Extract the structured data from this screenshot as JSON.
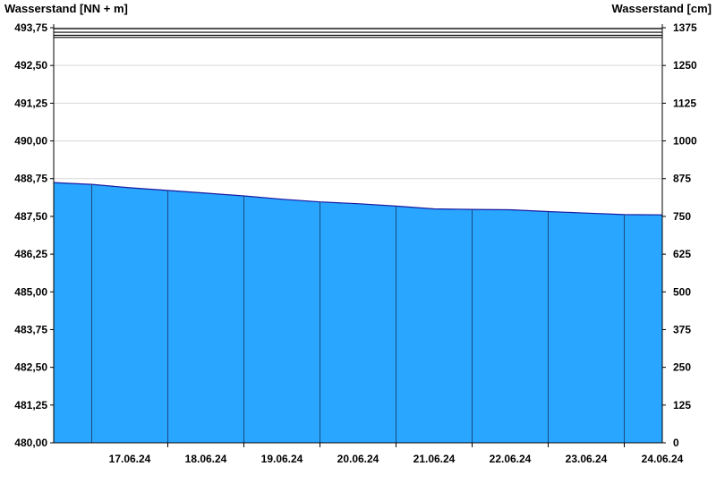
{
  "chart_data": {
    "type": "area",
    "ylabel_left": "Wasserstand [NN + m]",
    "ylabel_right": "Wasserstand [cm]",
    "left_axis": {
      "ylim": [
        480.0,
        493.75
      ],
      "ticks": [
        "480,00",
        "481,25",
        "482,50",
        "483,75",
        "485,00",
        "486,25",
        "487,50",
        "488,75",
        "490,00",
        "491,25",
        "492,50",
        "493,75"
      ]
    },
    "right_axis": {
      "ylim": [
        0,
        1375
      ],
      "ticks": [
        "0",
        "125",
        "250",
        "375",
        "500",
        "625",
        "750",
        "875",
        "1000",
        "1125",
        "1250",
        "1375"
      ]
    },
    "x_axis": {
      "range": [
        "16.06.24 12:00",
        "24.06.24 12:00"
      ],
      "ticks": [
        "17.06.24",
        "18.06.24",
        "19.06.24",
        "20.06.24",
        "21.06.24",
        "22.06.24",
        "23.06.24",
        "24.06.24"
      ]
    },
    "threshold_lines_cm": [
      1372,
      1360,
      1350,
      1343
    ],
    "grid": true,
    "fill_color": "#29a6ff",
    "series": [
      {
        "x": [
          "16.06.24 12:00",
          "17.06.24 00:00",
          "17.06.24 12:00",
          "18.06.24 00:00",
          "18.06.24 12:00",
          "19.06.24 00:00",
          "19.06.24 12:00",
          "20.06.24 00:00",
          "20.06.24 12:00",
          "21.06.24 00:00",
          "21.06.24 12:00",
          "22.06.24 00:00",
          "22.06.24 12:00",
          "23.06.24 00:00",
          "23.06.24 12:00",
          "24.06.24 00:00",
          "24.06.24 12:00"
        ],
        "values": [
          488.62,
          488.56,
          488.45,
          488.36,
          488.27,
          488.18,
          488.07,
          487.98,
          487.92,
          487.84,
          487.75,
          487.73,
          487.72,
          487.66,
          487.61,
          487.56,
          487.55
        ]
      }
    ]
  }
}
